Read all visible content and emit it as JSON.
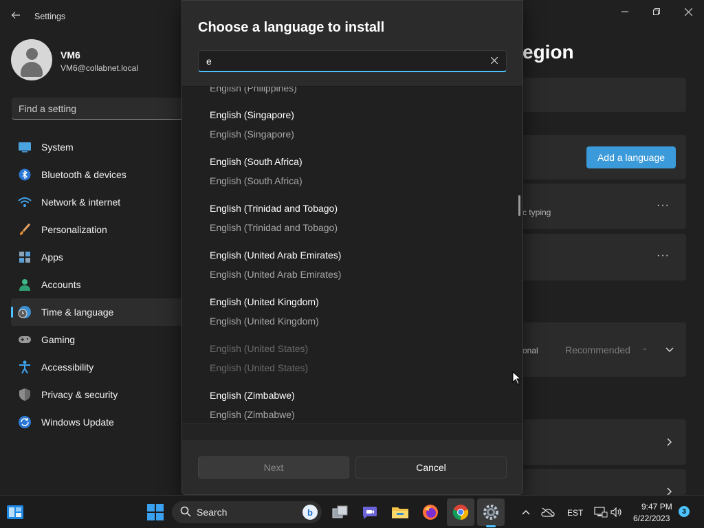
{
  "window": {
    "title": "Settings",
    "controls": {
      "minimize_icon": "minimize-icon",
      "maximize_icon": "restore-icon",
      "close_icon": "close-icon"
    }
  },
  "user": {
    "name": "VM6",
    "email": "VM6@collabnet.local"
  },
  "search": {
    "placeholder": "Find a setting"
  },
  "sidebar": {
    "items": [
      {
        "label": "System",
        "icon": "system-icon"
      },
      {
        "label": "Bluetooth & devices",
        "icon": "bluetooth-icon"
      },
      {
        "label": "Network & internet",
        "icon": "wifi-icon"
      },
      {
        "label": "Personalization",
        "icon": "brush-icon"
      },
      {
        "label": "Apps",
        "icon": "apps-icon"
      },
      {
        "label": "Accounts",
        "icon": "person-icon"
      },
      {
        "label": "Time & language",
        "icon": "globe-clock-icon",
        "active": true
      },
      {
        "label": "Gaming",
        "icon": "gamepad-icon"
      },
      {
        "label": "Accessibility",
        "icon": "accessibility-icon"
      },
      {
        "label": "Privacy & security",
        "icon": "shield-icon"
      },
      {
        "label": "Windows Update",
        "icon": "update-icon"
      }
    ]
  },
  "background_page": {
    "title_fragment": "egion",
    "add_language_label": "Add a language",
    "typing_fragment": "c typing",
    "personal_fragment": "onal",
    "recommended_label": "Recommended"
  },
  "dialog": {
    "title": "Choose a language to install",
    "search_value": "e",
    "languages": [
      {
        "name": "English (Philippines)",
        "native": "English (Philippines)",
        "disabled": false
      },
      {
        "name": "English (Singapore)",
        "native": "English (Singapore)",
        "disabled": false
      },
      {
        "name": "English (South Africa)",
        "native": "English (South Africa)",
        "disabled": false
      },
      {
        "name": "English (Trinidad and Tobago)",
        "native": "English (Trinidad and Tobago)",
        "disabled": false
      },
      {
        "name": "English (United Arab Emirates)",
        "native": "English (United Arab Emirates)",
        "disabled": false
      },
      {
        "name": "English (United Kingdom)",
        "native": "English (United Kingdom)",
        "disabled": false
      },
      {
        "name": "English (United States)",
        "native": "English (United States)",
        "disabled": true
      },
      {
        "name": "English (Zimbabwe)",
        "native": "English (Zimbabwe)",
        "disabled": false
      }
    ],
    "next_label": "Next",
    "cancel_label": "Cancel"
  },
  "taskbar": {
    "search_label": "Search",
    "input_indicator": "EST",
    "time": "9:47 PM",
    "date": "6/22/2023",
    "notification_count": "3",
    "accent": "#4cc2ff"
  }
}
